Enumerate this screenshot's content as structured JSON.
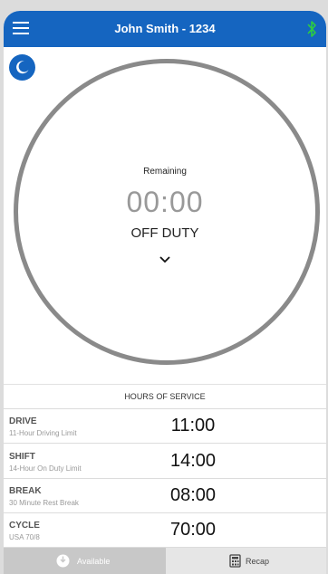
{
  "header": {
    "title": "John Smith - 1234"
  },
  "dial": {
    "remaining_label": "Remaining",
    "remaining_time": "00:00",
    "status": "OFF DUTY"
  },
  "hours_of_service": {
    "title": "HOURS OF SERVICE",
    "rows": [
      {
        "name": "DRIVE",
        "description": "11-Hour Driving Limit",
        "time": "11:00"
      },
      {
        "name": "SHIFT",
        "description": "14-Hour On Duty Limit",
        "time": "14:00"
      },
      {
        "name": "BREAK",
        "description": "30 Minute Rest Break",
        "time": "08:00"
      },
      {
        "name": "CYCLE",
        "description": "USA 70/8",
        "time": "70:00"
      }
    ]
  },
  "bottom_tabs": [
    {
      "label": "Available",
      "icon": "available-status-icon",
      "active": true
    },
    {
      "label": "Recap",
      "icon": "calculator-icon",
      "active": false
    }
  ],
  "colors": {
    "accent": "#1565c0",
    "bluetooth": "#2ecc40",
    "dial_ring": "#8a8a8a"
  },
  "icons": {
    "menu": "menu-icon",
    "bluetooth": "bluetooth-icon",
    "night_mode": "moon-icon",
    "expand": "chevron-down-icon"
  }
}
